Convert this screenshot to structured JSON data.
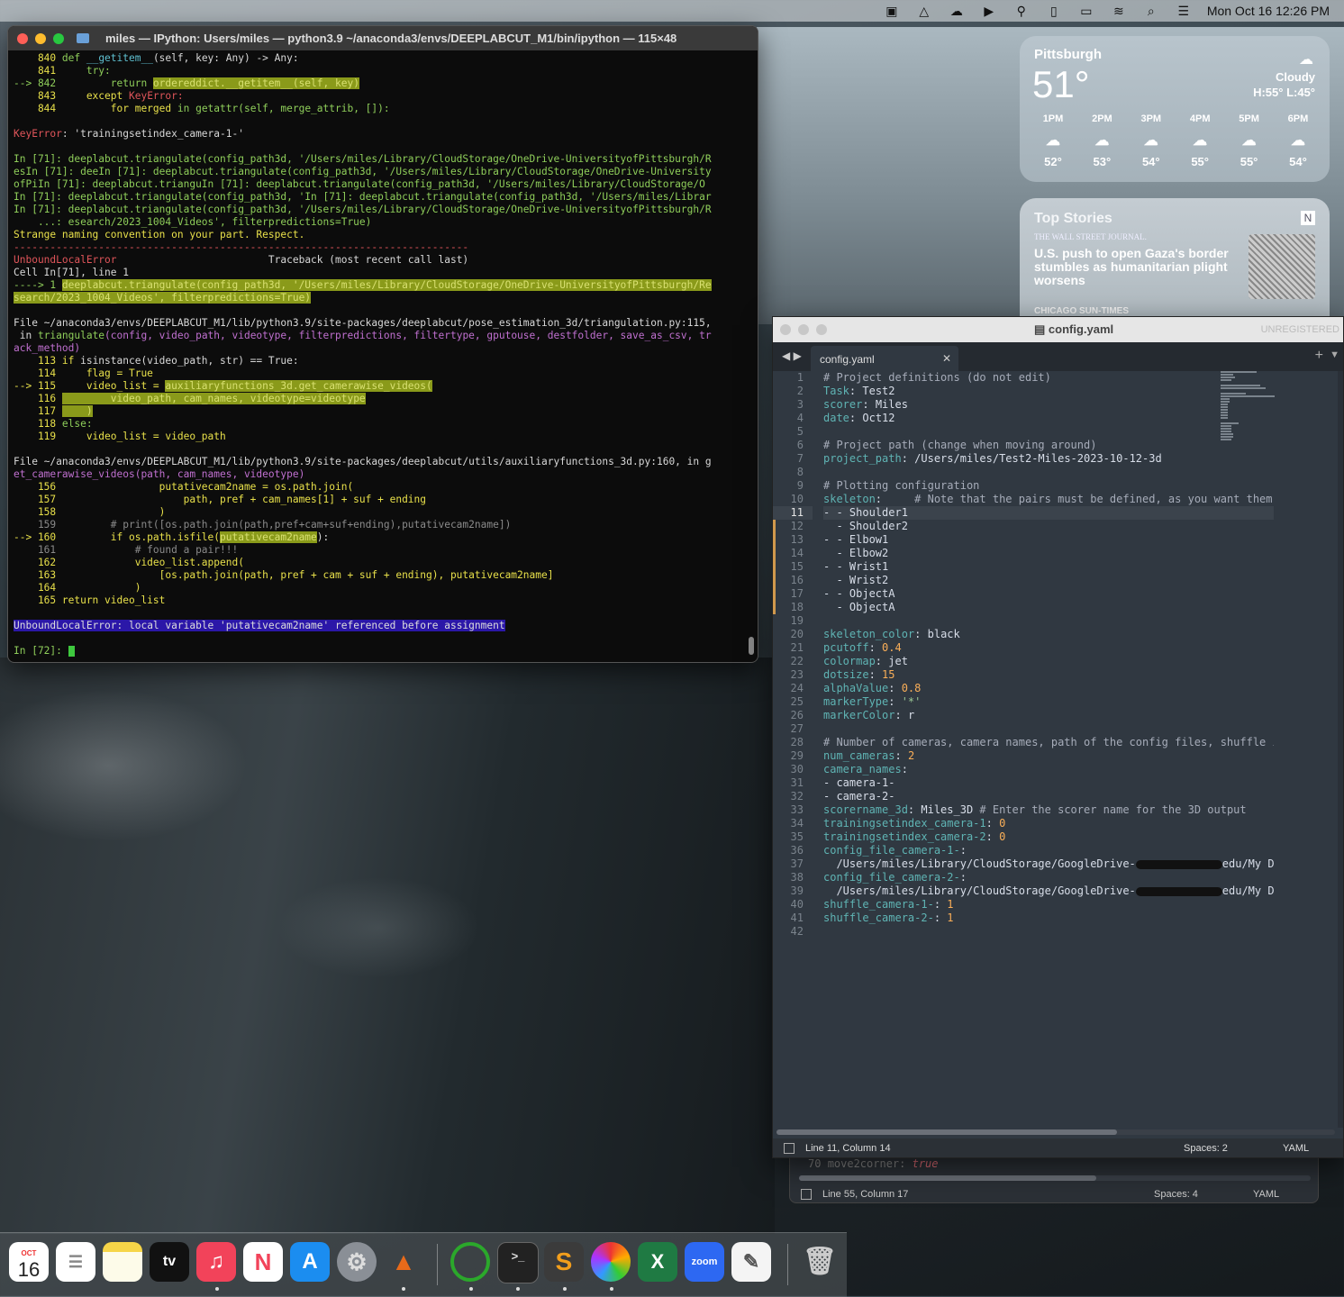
{
  "menubar": {
    "icons": [
      "display-icon",
      "drive-icon",
      "cloud-icon",
      "play-icon",
      "antenna-icon",
      "phone-icon",
      "battery-icon",
      "wifi-icon",
      "search-icon",
      "control-center-icon"
    ],
    "datetime": "Mon Oct 16  12:26 PM"
  },
  "terminal": {
    "title": "miles — IPython: Users/miles — python3.9 ~/anaconda3/envs/DEEPLABCUT_M1/bin/ipython — 115×48",
    "lines": [
      [
        "    840 ",
        "def ",
        "__getitem__",
        "(self, key: Any) -> Any:"
      ],
      [
        "    841     ",
        "try:"
      ],
      [
        "--> 842         return ",
        "ordereddict.__getitem__(self, key)"
      ],
      [
        "    843     except ",
        "KeyError:"
      ],
      [
        "    844         for merged ",
        "in ",
        "getattr(self, merge_attrib, []):"
      ],
      [
        ""
      ],
      [
        "KeyError",
        ": 'trainingsetindex_camera-1-'"
      ],
      [
        ""
      ],
      [
        "In [71]: deeplabcut.triangulate(config_path3d, '/Users/miles/Library/CloudStorage/OneDrive-UniversityofPittsburgh/R"
      ],
      [
        "esIn [71]: deeIn [71]: deeplabcut.triangulate(config_path3d, '/Users/miles/Library/CloudStorage/OneDrive-University"
      ],
      [
        "ofPiIn [71]: deeplabcut.trianguIn [71]: deeplabcut.triangulate(config_path3d, '/Users/miles/Library/CloudStorage/O"
      ],
      [
        "In [71]: deeplabcut.triangulate(config_path3d, 'In [71]: deeplabcut.triangulate(config_path3d, '/Users/miles/Librar"
      ],
      [
        "In [71]: deeplabcut.triangulate(config_path3d, '/Users/miles/Library/CloudStorage/OneDrive-UniversityofPittsburgh/R"
      ],
      [
        "    ...: esearch/2023_1004_Videos', filterpredictions=True)"
      ],
      [
        "Strange naming convention on your part. Respect."
      ],
      [
        "---------------------------------------------------------------------------"
      ],
      [
        "UnboundLocalError",
        "                         Traceback (most recent call last)"
      ],
      [
        "Cell In[71], line 1"
      ],
      [
        "----> 1 ",
        "deeplabcut.triangulate(config_path3d, '/Users/miles/Library/CloudStorage/OneDrive-UniversityofPittsburgh/Re"
      ],
      [
        "search/2023_1004_Videos', filterpredictions=True)"
      ],
      [
        ""
      ],
      [
        "File ",
        "~/anaconda3/envs/DEEPLABCUT_M1/lib/python3.9/site-packages/deeplabcut/pose_estimation_3d/triangulation.py:115,"
      ],
      [
        " in ",
        "triangulate",
        "(config, video_path, videotype, filterpredictions, filtertype, gputouse, destfolder, save_as_csv, tr"
      ],
      [
        "ack_method)"
      ],
      [
        "    113 if ",
        "isinstance(video_path, str) == True:"
      ],
      [
        "    114     flag = True"
      ],
      [
        "--> 115     video_list = ",
        "auxiliaryfunctions_3d.get_camerawise_videos("
      ],
      [
        "    116 ",
        "        video_path, cam_names, videotype=videotype"
      ],
      [
        "    117 ",
        "    )"
      ],
      [
        "    118 ",
        "else:"
      ],
      [
        "    119     video_list = video_path"
      ],
      [
        ""
      ],
      [
        "File ",
        "~/anaconda3/envs/DEEPLABCUT_M1/lib/python3.9/site-packages/deeplabcut/utils/auxiliaryfunctions_3d.py:160,",
        " in g"
      ],
      [
        "et_camerawise_videos(path, cam_names, videotype)"
      ],
      [
        "    156                 putativecam2name = os.path.join("
      ],
      [
        "    157                     path, pref + cam_names[1] + suf + ending"
      ],
      [
        "    158                 )"
      ],
      [
        "    159         # print([os.path.join(path,pref+cam+suf+ending),putativecam2name])"
      ],
      [
        "--> 160         if os.path.isfile(",
        "putativecam2name",
        "):"
      ],
      [
        "    161             # found a pair!!!"
      ],
      [
        "    162             video_list.append("
      ],
      [
        "    163                 [os.path.join(path, pref + cam + suf + ending), putativecam2name]"
      ],
      [
        "    164             )"
      ],
      [
        "    165 return video_list"
      ],
      [
        ""
      ],
      [
        "UnboundLocalError",
        ": local variable 'putativecam2name' referenced before assignment"
      ],
      [
        ""
      ],
      [
        "In [72]: "
      ]
    ]
  },
  "weather": {
    "city": "Pittsburgh",
    "temp": "51°",
    "condition": "Cloudy",
    "hilo": "H:55° L:45°",
    "hours": [
      {
        "time": "1PM",
        "temp": "52°"
      },
      {
        "time": "2PM",
        "temp": "53°"
      },
      {
        "time": "3PM",
        "temp": "54°"
      },
      {
        "time": "4PM",
        "temp": "55°"
      },
      {
        "time": "5PM",
        "temp": "55°"
      },
      {
        "time": "6PM",
        "temp": "54°"
      }
    ]
  },
  "news": {
    "heading": "Top Stories",
    "source": "THE WALL STREET JOURNAL.",
    "headline": "U.S. push to open Gaza's border stumbles as humanitarian plight worsens",
    "next_source": "CHICAGO SUN-TIMES"
  },
  "editor_back": {
    "line_no": "70",
    "code_key": "move2corner: ",
    "code_val": "true",
    "status_pos": "Line 55, Column 17",
    "status_spaces": "Spaces: 4",
    "status_syntax": "YAML"
  },
  "editor": {
    "title": "config.yaml",
    "unregistered": "UNREGISTERED",
    "tab_label": "config.yaml",
    "current_line": 11,
    "status_pos": "Line 11, Column 14",
    "status_spaces": "Spaces: 2",
    "status_syntax": "YAML",
    "lines": [
      "# Project definitions (do not edit)",
      "Task: Test2",
      "scorer: Miles",
      "date: Oct12",
      "",
      "# Project path (change when moving around)",
      "project_path: /Users/miles/Test2-Miles-2023-10-12-3d",
      "",
      "# Plotting configuration",
      "skeleton:     # Note that the pairs must be defined, as you want them l",
      "- - Shoulder1",
      "  - Shoulder2",
      "- - Elbow1",
      "  - Elbow2",
      "- - Wrist1",
      "  - Wrist2",
      "- - ObjectA",
      "  - ObjectA",
      "",
      "skeleton_color: black",
      "pcutoff: 0.4",
      "colormap: jet",
      "dotsize: 15",
      "alphaValue: 0.8",
      "markerType: '*'",
      "markerColor: r",
      "",
      "# Number of cameras, camera names, path of the config files, shuffle inc",
      "num_cameras: 2",
      "camera_names:",
      "- camera-1-",
      "- camera-2-",
      "scorername_3d: Miles_3D # Enter the scorer name for the 3D output",
      "trainingsetindex_camera-1: 0",
      "trainingsetindex_camera-2: 0",
      "config_file_camera-1-:",
      "  /Users/miles/Library/CloudStorage/GoogleDrive-",
      "config_file_camera-2-:",
      "  /Users/miles/Library/CloudStorage/GoogleDrive-",
      "shuffle_camera-1-: 1",
      "shuffle_camera-2-: 1",
      ""
    ],
    "redacted_tail": "edu/My Driv"
  },
  "dock": {
    "calendar_month": "OCT",
    "calendar_day": "16",
    "apps": [
      "calendar",
      "reminders",
      "notes",
      "apple-tv",
      "music",
      "news",
      "app-store",
      "system-settings",
      "matlab",
      "activity",
      "terminal",
      "sublime-text",
      "pinwheel",
      "excel",
      "zoom",
      "textedit",
      "trash"
    ],
    "tv_label": "tv",
    "zoom_label": "zoom",
    "excel_label": "X"
  }
}
